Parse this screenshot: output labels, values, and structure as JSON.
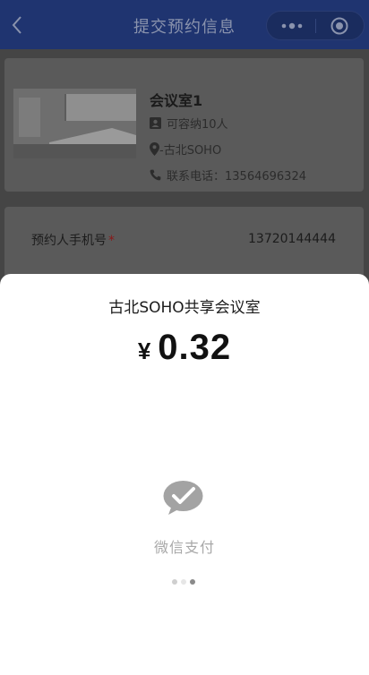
{
  "navbar": {
    "title": "提交预约信息",
    "back_icon": "chevron-left-icon",
    "menu_icon": "more-dots-icon",
    "close_icon": "target-circle-icon"
  },
  "room": {
    "name": "会议室1",
    "capacity": "可容纳10人",
    "address": "-古北SOHO",
    "phone": "联系电话：13564696324"
  },
  "form": {
    "phone_label": "预约人手机号",
    "required_mark": "*",
    "phone_value": "13720144444"
  },
  "payment": {
    "merchant": "古北SOHO共享会议室",
    "currency": "¥",
    "amount": "0.32",
    "method": "微信支付",
    "method_icon": "wechat-pay-icon"
  },
  "colors": {
    "navbar_bg": "#1f3470",
    "overlay_bg": "#454545",
    "sheet_bg": "#ffffff",
    "required": "#8a1818"
  }
}
